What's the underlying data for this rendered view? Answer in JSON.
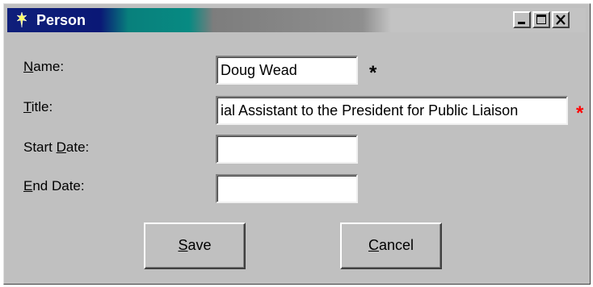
{
  "window": {
    "title": "Person",
    "controls": {
      "minimize": "minimize-icon",
      "maximize": "maximize-icon",
      "close": "close-icon"
    }
  },
  "form": {
    "name": {
      "label_accel": "N",
      "label_rest": "ame:",
      "value": "Doug Wead",
      "required_marker": "*",
      "marker_color": "#000000"
    },
    "title": {
      "label_accel": "T",
      "label_rest": "itle:",
      "value": "ial Assistant to the President for Public Liaison",
      "required_marker": "*",
      "marker_color": "#ff0000"
    },
    "start_date": {
      "label_pre": "Start ",
      "label_accel": "D",
      "label_rest": "ate:",
      "value": ""
    },
    "end_date": {
      "label_accel": "E",
      "label_rest": "nd Date:",
      "value": ""
    }
  },
  "buttons": {
    "save": {
      "accel": "S",
      "rest": "ave"
    },
    "cancel": {
      "accel": "C",
      "rest": "ancel"
    }
  },
  "colors": {
    "titlebar_dark": "#0a1876",
    "titlebar_teal": "#078a82",
    "face": "#c0c0c0"
  }
}
